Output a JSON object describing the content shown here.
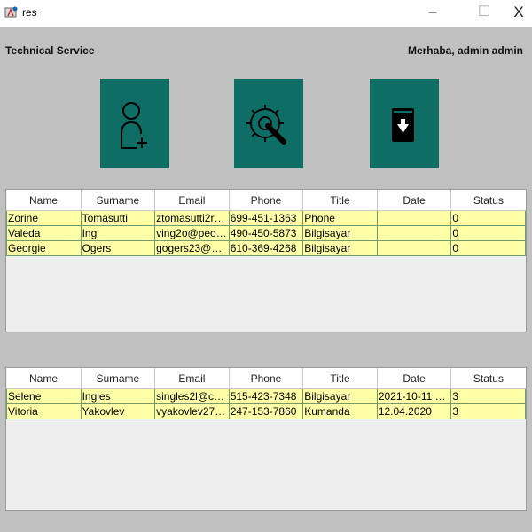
{
  "window": {
    "title": "res",
    "minimize_glyph": "–",
    "maximize_glyph": "☐",
    "close_glyph": "X"
  },
  "header": {
    "app_name": "Technical Service",
    "greeting": "Merhaba, admin admin"
  },
  "toolbar": {
    "tiles": [
      {
        "icon": "add-user-icon"
      },
      {
        "icon": "settings-wrench-icon"
      },
      {
        "icon": "archive-download-icon"
      }
    ],
    "accent_color": "#0e6e66"
  },
  "table_columns": [
    "Name",
    "Surname",
    "Email",
    "Phone",
    "Title",
    "Date",
    "Status"
  ],
  "open_requests": {
    "rows": [
      [
        "Zorine",
        "Tomasutti",
        "ztomasutti2r@...",
        "699-451-1363",
        "Phone",
        "",
        "0"
      ],
      [
        "Valeda",
        "Ing",
        "ving2o@peopl...",
        "490-450-5873",
        "Bilgisayar",
        "",
        "0"
      ],
      [
        "Georgie",
        "Ogers",
        "gogers23@net...",
        "610-369-4268",
        "Bilgisayar",
        "",
        "0"
      ]
    ]
  },
  "processed_requests": {
    "rows": [
      [
        "Selene",
        "Ingles",
        "singles2l@crai...",
        "515-423-7348",
        "Bilgisayar",
        "2021-10-11 01:...",
        "3"
      ],
      [
        "Vitoria",
        "Yakovlev",
        "vyakovlev27@s...",
        "247-153-7860",
        "Kumanda",
        "12.04.2020",
        "3"
      ]
    ]
  },
  "colors": {
    "row_background": "#ffffa8",
    "row_border": "#6f9c6f",
    "panel_background": "#eeeeee",
    "window_background": "#c0c0c0"
  }
}
